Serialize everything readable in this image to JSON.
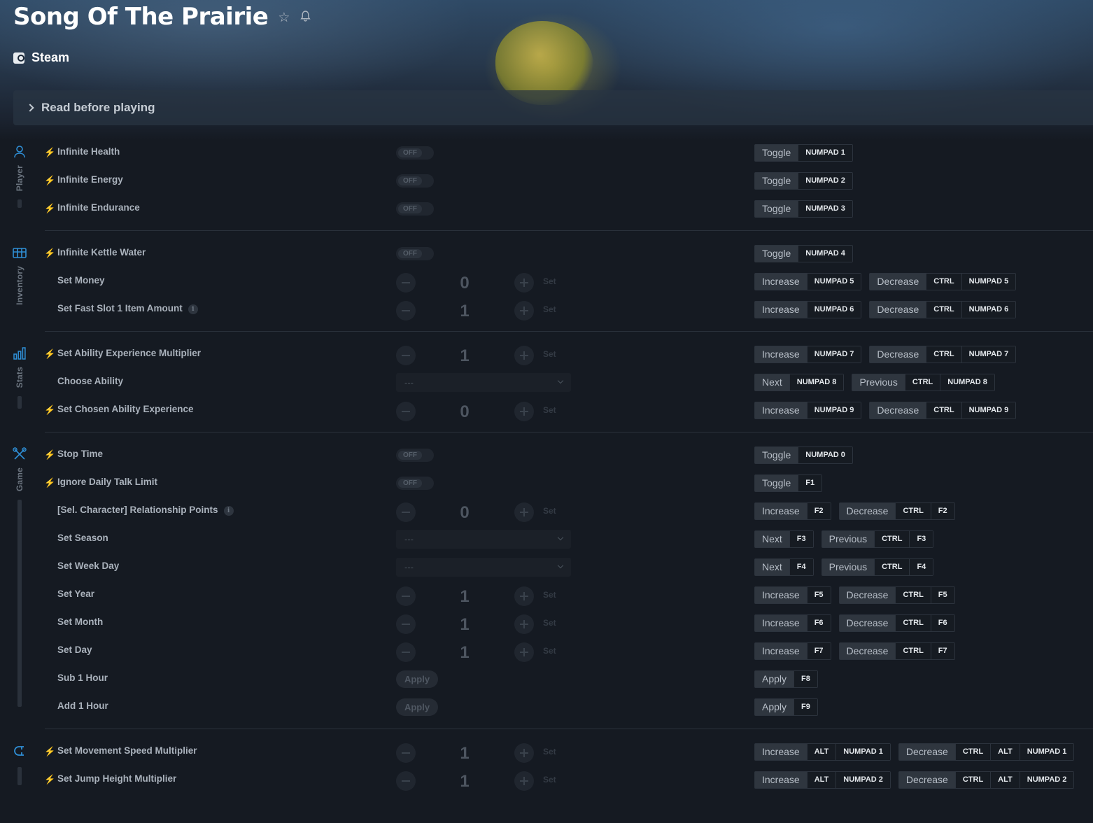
{
  "header": {
    "title": "Song Of The Prairie",
    "favorite_icon": "star-icon",
    "notify_icon": "bell-icon",
    "platform": "Steam",
    "read_before": "Read before playing"
  },
  "categories": {
    "player": "Player",
    "inventory": "Inventory",
    "stats": "Stats",
    "game": "Game"
  },
  "cheats": [
    {
      "label": "Infinite Health",
      "toggle": "OFF",
      "keys": [
        [
          "Toggle",
          "NUMPAD 1"
        ]
      ]
    },
    {
      "label": "Infinite Energy",
      "toggle": "OFF",
      "keys": [
        [
          "Toggle",
          "NUMPAD 2"
        ]
      ]
    },
    {
      "label": "Infinite Endurance",
      "toggle": "OFF",
      "keys": [
        [
          "Toggle",
          "NUMPAD 3"
        ]
      ]
    },
    {
      "label": "Infinite Kettle Water",
      "toggle": "OFF",
      "keys": [
        [
          "Toggle",
          "NUMPAD 4"
        ]
      ]
    },
    {
      "label": "Set Money",
      "value": "0",
      "set": "Set",
      "keys": [
        [
          "Increase",
          "NUMPAD 5"
        ],
        [
          "Decrease",
          "CTRL",
          "NUMPAD 5"
        ]
      ]
    },
    {
      "label": "Set Fast Slot 1 Item Amount",
      "value": "1",
      "set": "Set",
      "keys": [
        [
          "Increase",
          "NUMPAD 6"
        ],
        [
          "Decrease",
          "CTRL",
          "NUMPAD 6"
        ]
      ]
    },
    {
      "label": "Set Ability Experience Multiplier",
      "value": "1",
      "set": "Set",
      "keys": [
        [
          "Increase",
          "NUMPAD 7"
        ],
        [
          "Decrease",
          "CTRL",
          "NUMPAD 7"
        ]
      ]
    },
    {
      "label": "Choose Ability",
      "dropdown": "---",
      "keys": [
        [
          "Next",
          "NUMPAD 8"
        ],
        [
          "Previous",
          "CTRL",
          "NUMPAD 8"
        ]
      ]
    },
    {
      "label": "Set Chosen Ability Experience",
      "value": "0",
      "set": "Set",
      "keys": [
        [
          "Increase",
          "NUMPAD 9"
        ],
        [
          "Decrease",
          "CTRL",
          "NUMPAD 9"
        ]
      ]
    },
    {
      "label": "Stop Time",
      "toggle": "OFF",
      "keys": [
        [
          "Toggle",
          "NUMPAD 0"
        ]
      ]
    },
    {
      "label": "Ignore Daily Talk Limit",
      "toggle": "OFF",
      "keys": [
        [
          "Toggle",
          "F1"
        ]
      ]
    },
    {
      "label": "[Sel. Character] Relationship Points",
      "value": "0",
      "set": "Set",
      "keys": [
        [
          "Increase",
          "F2"
        ],
        [
          "Decrease",
          "CTRL",
          "F2"
        ]
      ]
    },
    {
      "label": "Set Season",
      "dropdown": "---",
      "keys": [
        [
          "Next",
          "F3"
        ],
        [
          "Previous",
          "CTRL",
          "F3"
        ]
      ]
    },
    {
      "label": "Set Week Day",
      "dropdown": "---",
      "keys": [
        [
          "Next",
          "F4"
        ],
        [
          "Previous",
          "CTRL",
          "F4"
        ]
      ]
    },
    {
      "label": "Set Year",
      "value": "1",
      "set": "Set",
      "keys": [
        [
          "Increase",
          "F5"
        ],
        [
          "Decrease",
          "CTRL",
          "F5"
        ]
      ]
    },
    {
      "label": "Set Month",
      "value": "1",
      "set": "Set",
      "keys": [
        [
          "Increase",
          "F6"
        ],
        [
          "Decrease",
          "CTRL",
          "F6"
        ]
      ]
    },
    {
      "label": "Set Day",
      "value": "1",
      "set": "Set",
      "keys": [
        [
          "Increase",
          "F7"
        ],
        [
          "Decrease",
          "CTRL",
          "F7"
        ]
      ]
    },
    {
      "label": "Sub 1 Hour",
      "apply": "Apply",
      "keys": [
        [
          "Apply",
          "F8"
        ]
      ]
    },
    {
      "label": "Add 1 Hour",
      "apply": "Apply",
      "keys": [
        [
          "Apply",
          "F9"
        ]
      ]
    },
    {
      "label": "Set Movement Speed Multiplier",
      "value": "1",
      "set": "Set",
      "keys": [
        [
          "Increase",
          "ALT",
          "NUMPAD 1"
        ],
        [
          "Decrease",
          "CTRL",
          "ALT",
          "NUMPAD 1"
        ]
      ]
    },
    {
      "label": "Set Jump Height Multiplier",
      "value": "1",
      "set": "Set",
      "keys": [
        [
          "Increase",
          "ALT",
          "NUMPAD 2"
        ],
        [
          "Decrease",
          "CTRL",
          "ALT",
          "NUMPAD 2"
        ]
      ]
    }
  ],
  "bolt_icon": "lightning-icon",
  "info_glyph": "i"
}
